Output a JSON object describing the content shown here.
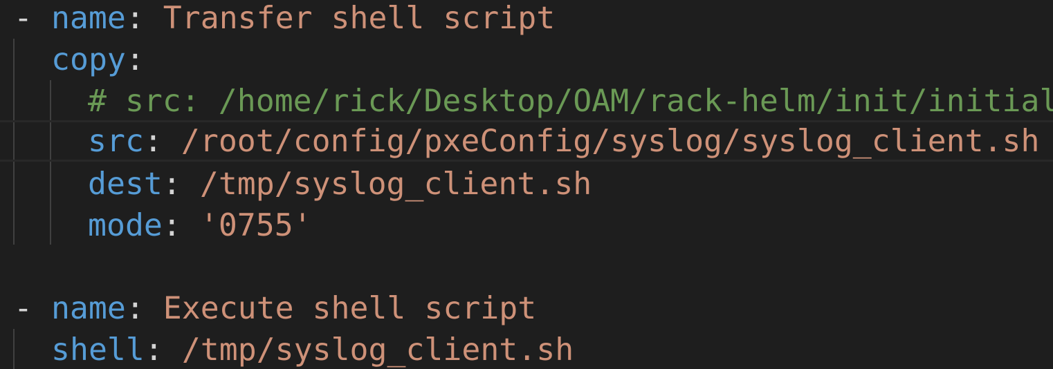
{
  "editor": {
    "language": "yaml",
    "colors": {
      "background": "#1e1e1e",
      "key": "#569cd6",
      "string": "#ce9178",
      "comment": "#6a9955",
      "punctuation": "#d4d4d4",
      "indent_guide": "#404040"
    },
    "lines": [
      {
        "dash": "- ",
        "key": "name",
        "colon": ": ",
        "value": "Transfer shell script"
      },
      {
        "key": "copy",
        "colon": ":",
        "value": ""
      },
      {
        "comment": "# src: /home/rick/Desktop/OAM/rack-helm/init/initial"
      },
      {
        "key": "src",
        "colon": ": ",
        "value": "/root/config/pxeConfig/syslog/syslog_client.sh"
      },
      {
        "key": "dest",
        "colon": ": ",
        "value": "/tmp/syslog_client.sh"
      },
      {
        "key": "mode",
        "colon": ": ",
        "value": "'0755'"
      },
      {
        "blank": ""
      },
      {
        "dash": "- ",
        "key": "name",
        "colon": ": ",
        "value": "Execute shell script"
      },
      {
        "key": "shell",
        "colon": ": ",
        "value": "/tmp/syslog_client.sh"
      }
    ]
  }
}
